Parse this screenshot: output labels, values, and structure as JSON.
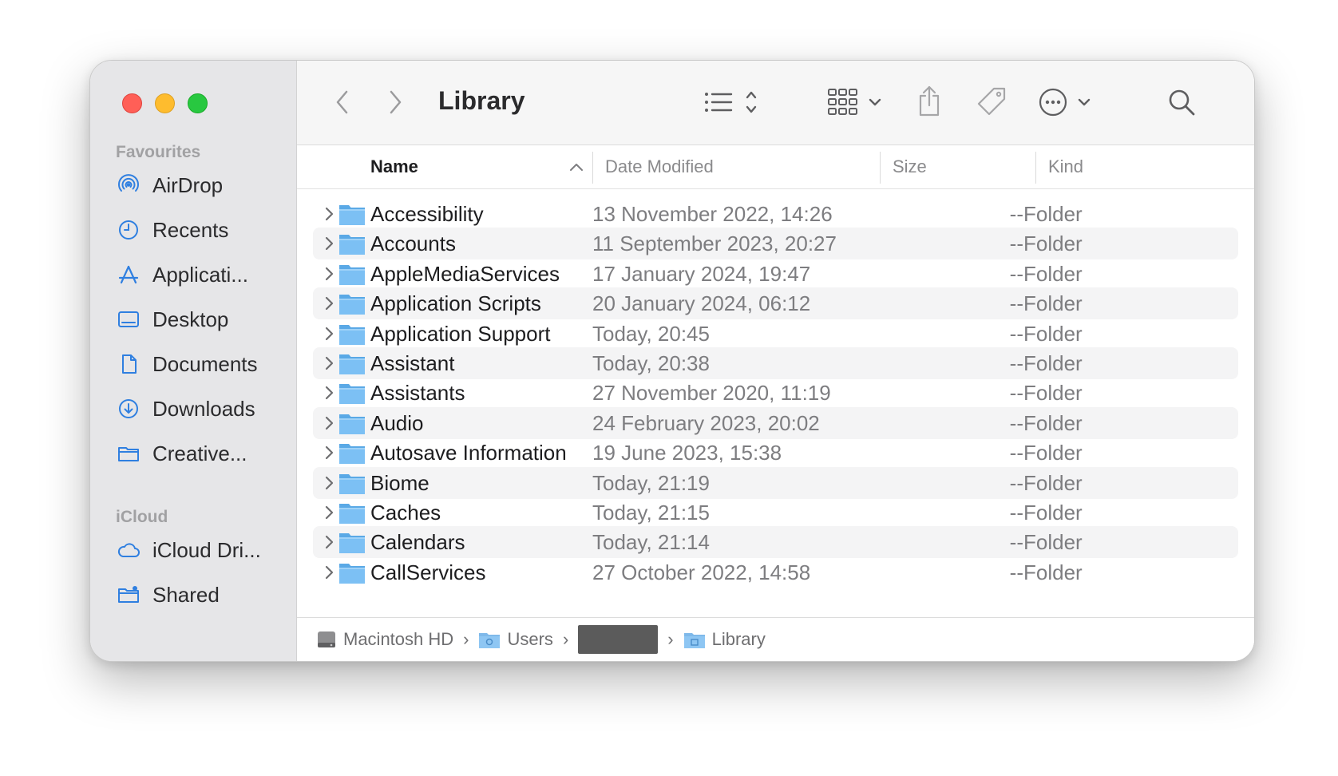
{
  "window": {
    "title": "Library"
  },
  "sidebar": {
    "sections": [
      {
        "title": "Favourites",
        "items": [
          {
            "label": "AirDrop",
            "icon": "airdrop-icon"
          },
          {
            "label": "Recents",
            "icon": "clock-icon"
          },
          {
            "label": "Applicati...",
            "icon": "applications-icon"
          },
          {
            "label": "Desktop",
            "icon": "desktop-icon"
          },
          {
            "label": "Documents",
            "icon": "document-icon"
          },
          {
            "label": "Downloads",
            "icon": "download-icon"
          },
          {
            "label": "Creative...",
            "icon": "folder-icon"
          }
        ]
      },
      {
        "title": "iCloud",
        "items": [
          {
            "label": "iCloud Dri...",
            "icon": "cloud-icon"
          },
          {
            "label": "Shared",
            "icon": "shared-folder-icon"
          }
        ]
      }
    ]
  },
  "columns": {
    "name": "Name",
    "date": "Date Modified",
    "size": "Size",
    "kind": "Kind"
  },
  "rows": [
    {
      "name": "Accessibility",
      "date": "13 November 2022, 14:26",
      "size": "--",
      "kind": "Folder"
    },
    {
      "name": "Accounts",
      "date": "11 September 2023, 20:27",
      "size": "--",
      "kind": "Folder"
    },
    {
      "name": "AppleMediaServices",
      "date": "17 January 2024, 19:47",
      "size": "--",
      "kind": "Folder"
    },
    {
      "name": "Application Scripts",
      "date": "20 January 2024, 06:12",
      "size": "--",
      "kind": "Folder"
    },
    {
      "name": "Application Support",
      "date": "Today, 20:45",
      "size": "--",
      "kind": "Folder"
    },
    {
      "name": "Assistant",
      "date": "Today, 20:38",
      "size": "--",
      "kind": "Folder"
    },
    {
      "name": "Assistants",
      "date": "27 November 2020, 11:19",
      "size": "--",
      "kind": "Folder"
    },
    {
      "name": "Audio",
      "date": "24 February 2023, 20:02",
      "size": "--",
      "kind": "Folder"
    },
    {
      "name": "Autosave Information",
      "date": "19 June 2023, 15:38",
      "size": "--",
      "kind": "Folder"
    },
    {
      "name": "Biome",
      "date": "Today, 21:19",
      "size": "--",
      "kind": "Folder"
    },
    {
      "name": "Caches",
      "date": "Today, 21:15",
      "size": "--",
      "kind": "Folder"
    },
    {
      "name": "Calendars",
      "date": "Today, 21:14",
      "size": "--",
      "kind": "Folder"
    },
    {
      "name": "CallServices",
      "date": "27 October 2022, 14:58",
      "size": "--",
      "kind": "Folder"
    }
  ],
  "pathbar": {
    "drive": "Macintosh HD",
    "users": "Users",
    "library": "Library"
  },
  "colors": {
    "accent": "#2f7fe0",
    "folder": "#6cb8f0",
    "sidebar_bg": "#e6e6e8"
  }
}
